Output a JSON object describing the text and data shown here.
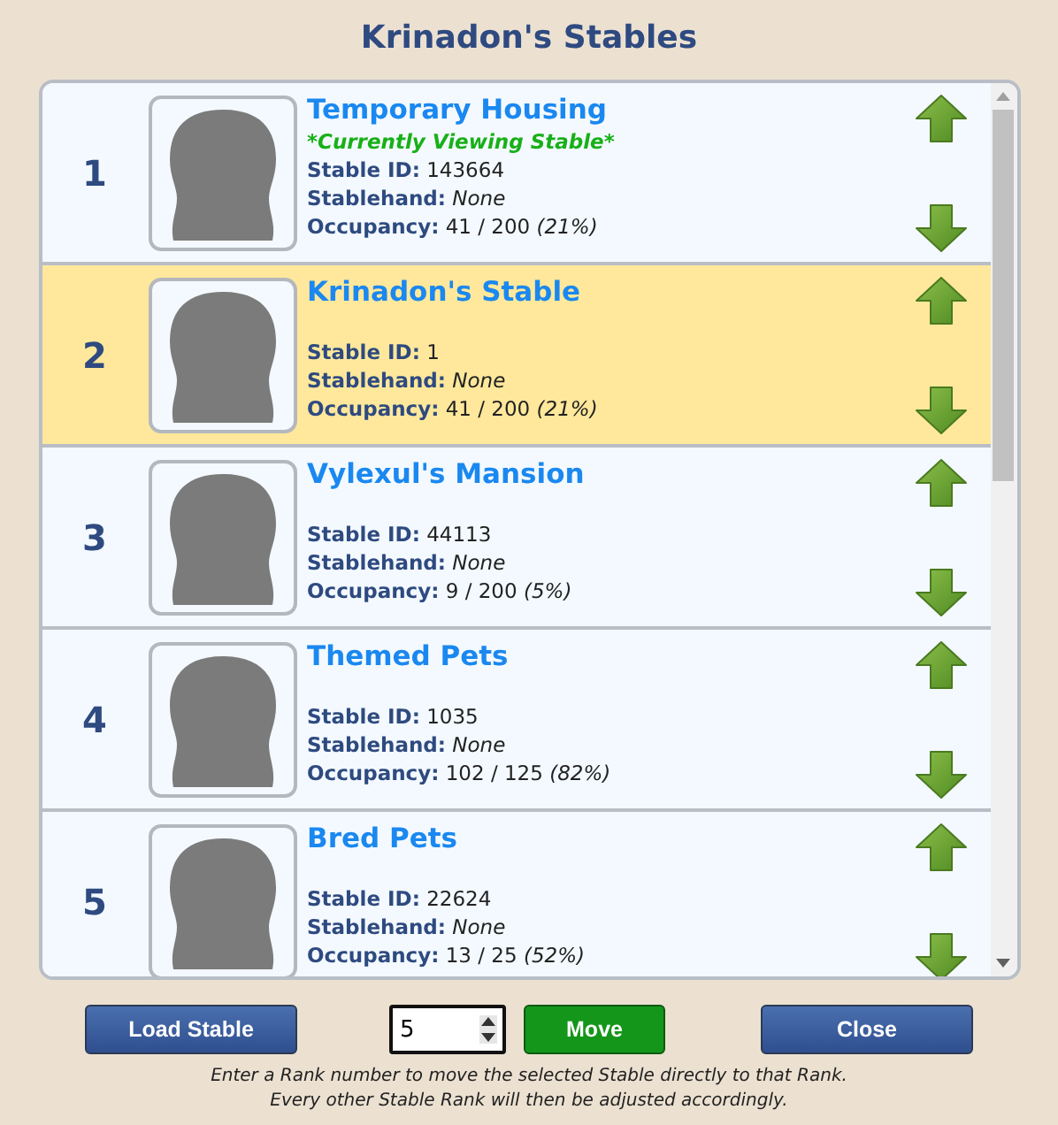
{
  "title": "Krinadon's Stables",
  "stables": [
    {
      "rank": "1",
      "name": "Temporary Housing",
      "status": "*Currently Viewing Stable*",
      "id_label": "Stable ID:",
      "stable_id": "143664",
      "hand_label": "Stablehand:",
      "stablehand": "None",
      "occ_label": "Occupancy:",
      "occupancy": "41 / 200",
      "percent": "(21%)",
      "selected": false
    },
    {
      "rank": "2",
      "name": "Krinadon's Stable",
      "id_label": "Stable ID:",
      "stable_id": "1",
      "hand_label": "Stablehand:",
      "stablehand": "None",
      "occ_label": "Occupancy:",
      "occupancy": "41 / 200",
      "percent": "(21%)",
      "selected": true
    },
    {
      "rank": "3",
      "name": "Vylexul's Mansion",
      "id_label": "Stable ID:",
      "stable_id": "44113",
      "hand_label": "Stablehand:",
      "stablehand": "None",
      "occ_label": "Occupancy:",
      "occupancy": "9 / 200",
      "percent": "(5%)",
      "selected": false
    },
    {
      "rank": "4",
      "name": "Themed Pets",
      "id_label": "Stable ID:",
      "stable_id": "1035",
      "hand_label": "Stablehand:",
      "stablehand": "None",
      "occ_label": "Occupancy:",
      "occupancy": "102 / 125",
      "percent": "(82%)",
      "selected": false
    },
    {
      "rank": "5",
      "name": "Bred Pets",
      "id_label": "Stable ID:",
      "stable_id": "22624",
      "hand_label": "Stablehand:",
      "stablehand": "None",
      "occ_label": "Occupancy:",
      "occupancy": "13 / 25",
      "percent": "(52%)",
      "selected": false
    }
  ],
  "buttons": {
    "load": "Load Stable",
    "rank_value": "5",
    "move": "Move",
    "close": "Close"
  },
  "note": [
    "Enter a Rank number to move the selected Stable directly to that Rank.",
    "Every other Stable Rank will then be adjusted accordingly."
  ]
}
